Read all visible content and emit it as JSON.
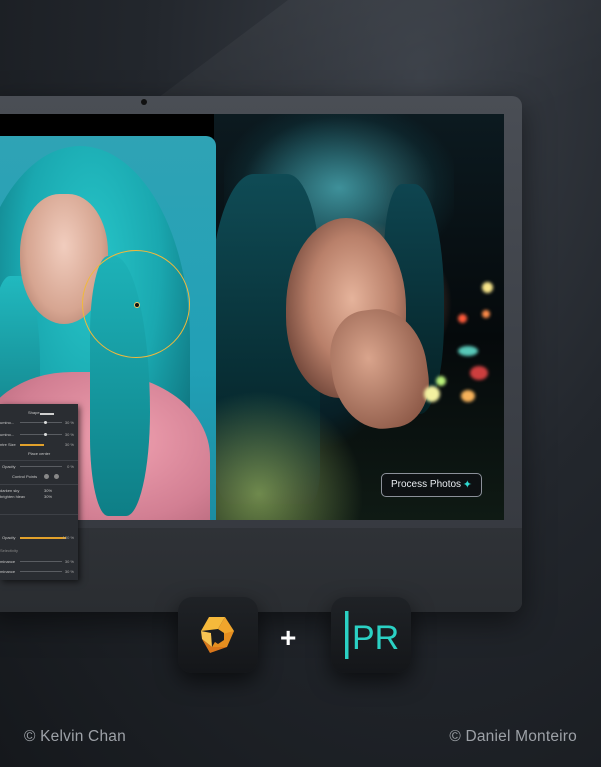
{
  "editor_panel": {
    "shape_label": "Shape",
    "rows": [
      {
        "label": "umino...",
        "value": "30 %"
      },
      {
        "label": "umino...",
        "value": "30 %"
      },
      {
        "label": "ntre Size",
        "value": "30 %"
      }
    ],
    "place_center": "Place center",
    "opacity_label": "Opacity",
    "opacity_value": "0 %",
    "control_points": "Control Points",
    "list_item_1": "darken sky",
    "list_item_1_value": "30%",
    "list_item_2": "brighten hleav",
    "list_item_2_value": "30%",
    "opacity2_label": "Opacity",
    "opacity2_value": "100 %",
    "selectivity_label": "Selectivity",
    "lum1_label": "minance",
    "lum1_value": "30 %",
    "lum2_label": "minance",
    "lum2_value": "30 %"
  },
  "process_button": {
    "label": "Process Photos",
    "icon": "sparkle-icon"
  },
  "apps": [
    {
      "name": "nik-collection",
      "icon": "aperture-icon",
      "color": "#f2a93b"
    },
    {
      "name": "pr",
      "icon": "pr-logo-icon",
      "letters": "PR",
      "color": "#2bd1c4"
    }
  ],
  "plus": "+",
  "credits": {
    "left": "© Kelvin Chan",
    "right": "© Daniel Monteiro"
  }
}
